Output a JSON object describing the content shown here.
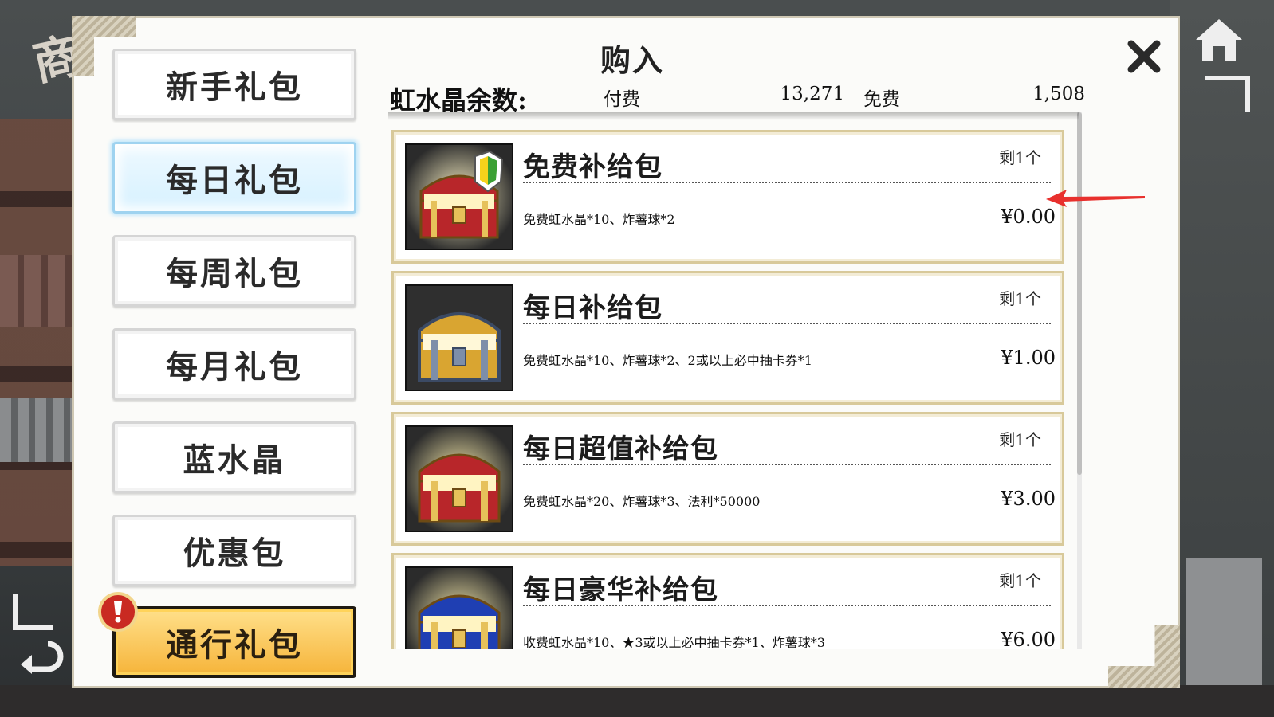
{
  "background": {
    "sign_text": "商店"
  },
  "dialog": {
    "title": "购入",
    "balance": {
      "label": "虹水晶余数:",
      "paid_label": "付费",
      "paid_value": "13,271",
      "free_label": "免费",
      "free_value": "1,508"
    }
  },
  "tabs": [
    {
      "label": "新手礼包",
      "state": "normal"
    },
    {
      "label": "每日礼包",
      "state": "active"
    },
    {
      "label": "每周礼包",
      "state": "normal"
    },
    {
      "label": "每月礼包",
      "state": "normal"
    },
    {
      "label": "蓝水晶",
      "state": "normal"
    },
    {
      "label": "优惠包",
      "state": "normal"
    },
    {
      "label": "通行礼包",
      "state": "highlight",
      "alert": "!"
    }
  ],
  "items": [
    {
      "name": "免费补给包",
      "stock": "剩1个",
      "desc": "免费虹水晶*10、炸薯球*2",
      "price": "¥0.00",
      "chest": "red",
      "badge": "beginner-leaf"
    },
    {
      "name": "每日补给包",
      "stock": "剩1个",
      "desc": "免费虹水晶*10、炸薯球*2、2或以上必中抽卡券*1",
      "price": "¥1.00",
      "chest": "gold"
    },
    {
      "name": "每日超值补给包",
      "stock": "剩1个",
      "desc": "免费虹水晶*20、炸薯球*3、法利*50000",
      "price": "¥3.00",
      "chest": "red"
    },
    {
      "name": "每日豪华补给包",
      "stock": "剩1个",
      "desc": "收费虹水晶*10、★3或以上必中抽卡券*1、炸薯球*3",
      "price": "¥6.00",
      "chest": "blue"
    }
  ],
  "colors": {
    "chest_red": "#b8262a",
    "chest_gold": "#d9a531",
    "chest_blue": "#1f3fb3",
    "arrow": "#e8302d"
  }
}
